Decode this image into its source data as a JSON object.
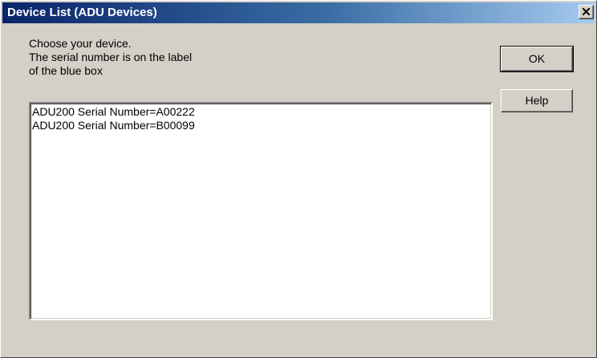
{
  "window": {
    "title": "Device List (ADU Devices)",
    "close_icon": "close-icon"
  },
  "instructions": {
    "line1": "Choose your device.",
    "line2": "The serial number is on the label",
    "line3": "of the blue box"
  },
  "devices": [
    "ADU200 Serial Number=A00222",
    "ADU200 Serial Number=B00099"
  ],
  "buttons": {
    "ok_label": "OK",
    "help_label": "Help"
  },
  "colors": {
    "title_bar_start": "#0a246a",
    "title_bar_end": "#a6caf0",
    "dialog_background": "#d4d0c8",
    "list_background": "#ffffff"
  }
}
